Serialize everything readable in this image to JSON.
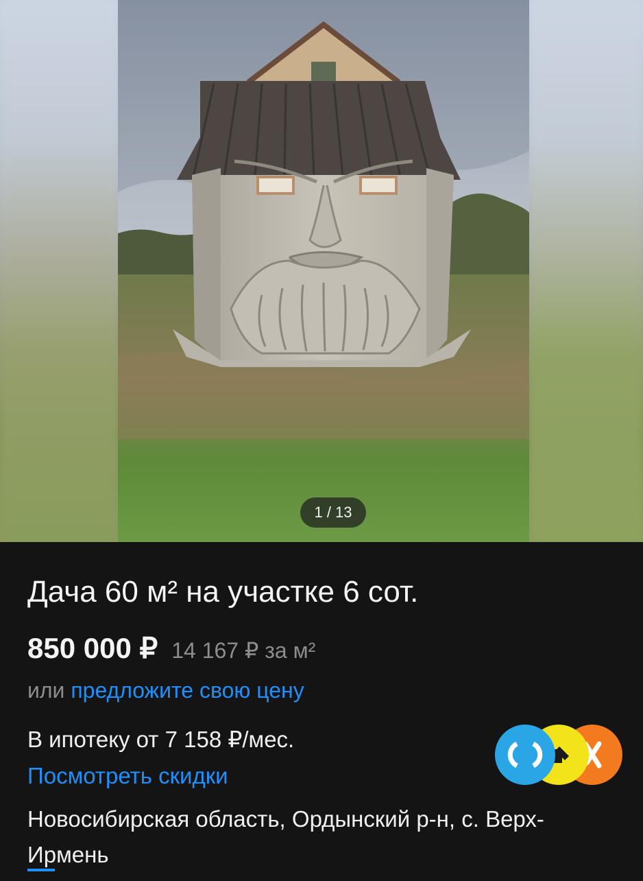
{
  "gallery": {
    "counter": "1 / 13",
    "photo_icon": "house-with-carved-face-photo"
  },
  "listing": {
    "title": "Дача 60 м² на участке 6 сот.",
    "price": "850 000 ₽",
    "price_per_m2": "14 167 ₽ за м²",
    "offer_prefix": "или ",
    "offer_link": "предложите свою цену",
    "mortgage": "В ипотеку от 7 158 ₽/мес.",
    "discounts_link": "Посмотреть скидки",
    "address": "Новосибирская область, Ордынский р-н, с. Верх-Ирмень"
  },
  "partners": {
    "icon": "partner-banks-logos",
    "colors": [
      "#2aa6e6",
      "#f3e31a",
      "#f47a1f"
    ]
  },
  "colors": {
    "background": "#141414",
    "text": "#f4f4f4",
    "muted": "#8d8d8d",
    "link": "#1f8ffb"
  }
}
